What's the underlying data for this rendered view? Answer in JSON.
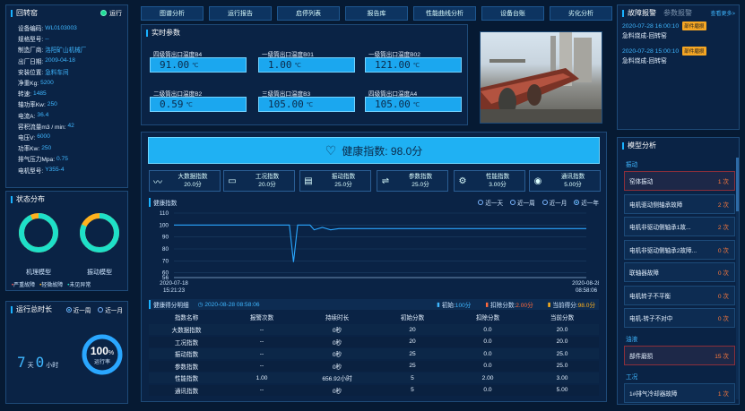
{
  "left": {
    "title": "回转窑",
    "status": "运行",
    "props": [
      {
        "k": "设备编码:",
        "v": "WL0103003"
      },
      {
        "k": "规格型号:",
        "v": "--"
      },
      {
        "k": "制造厂商:",
        "v": "洛阳矿山机械厂"
      },
      {
        "k": "出厂日期:",
        "v": "2009-04-18"
      },
      {
        "k": "安装位置:",
        "v": "急料车间"
      },
      {
        "k": "净重Kg:",
        "v": "5200"
      },
      {
        "k": "转速:",
        "v": "1485"
      },
      {
        "k": "轴功率Kw:",
        "v": "250"
      },
      {
        "k": "电流A:",
        "v": "36.4"
      },
      {
        "k": "容积流量m3 / min:",
        "v": "42"
      },
      {
        "k": "电压V:",
        "v": "6000"
      },
      {
        "k": "功率Kw:",
        "v": "250"
      },
      {
        "k": "排气压力Mpa:",
        "v": "0.75"
      },
      {
        "k": "电机型号:",
        "v": "Y355-4"
      }
    ],
    "status_title": "状态分布",
    "gauge1_label": "机理模型",
    "gauge2_label": "振动模型",
    "gauge1_fraction": 0.93,
    "gauge2_fraction": 0.82,
    "legend": [
      "严重故障",
      "轻微故障",
      "未见异常"
    ],
    "runtime_title": "运行总时长",
    "runtime_opts": [
      "近一周",
      "近一月"
    ],
    "runtime_days": "7",
    "runtime_hours": "0",
    "day_unit": "天",
    "hour_unit": "小时",
    "rate_value": "100",
    "rate_unit": "%",
    "rate_label": "运行率",
    "rate_fraction": 1.0
  },
  "tabs": [
    "图谱分析",
    "运行报告",
    "启停列表",
    "报告库",
    "性能曲线分析",
    "设备台账",
    "劣化分析"
  ],
  "realtime": {
    "title": "实时参数",
    "items": [
      {
        "name": "四级筒出口温度B4",
        "value": "91.00",
        "unit": "℃"
      },
      {
        "name": "一级筒出口温度B01",
        "value": "1.00",
        "unit": "℃"
      },
      {
        "name": "一级筒出口温度B02",
        "value": "121.00",
        "unit": "℃"
      },
      {
        "name": "二级筒出口温度B2",
        "value": "0.59",
        "unit": "℃"
      },
      {
        "name": "三级筒出口温度B3",
        "value": "105.00",
        "unit": "℃"
      },
      {
        "name": "四级筒出口温度A4",
        "value": "105.00",
        "unit": "℃"
      }
    ]
  },
  "health": {
    "label": "健康指数: 98.0分",
    "chips": [
      {
        "name": "大数据指数",
        "value": "20.0分",
        "icon": "〰"
      },
      {
        "name": "工况指数",
        "value": "20.0分",
        "icon": "▭"
      },
      {
        "name": "振动指数",
        "value": "25.0分",
        "icon": "▤"
      },
      {
        "name": "参数指数",
        "value": "25.0分",
        "icon": "⇌"
      },
      {
        "name": "性能指数",
        "value": "3.00分",
        "icon": "⚙"
      },
      {
        "name": "通讯指数",
        "value": "5.00分",
        "icon": "◉"
      }
    ],
    "chart_title": "健康指数",
    "chart_opts": [
      "近一天",
      "近一周",
      "近一月",
      "近一年"
    ]
  },
  "chart_data": {
    "type": "line",
    "title": "健康指数",
    "x_start": "2020-07-18 15:21:23",
    "x_end": "2020-08-28 08:58:06",
    "x_start_date": "2020-07-18",
    "x_start_time": "15:21:23",
    "x_end_date": "2020-08-28",
    "x_end_time": "08:58:06",
    "yticks": [
      "110",
      "100",
      "90",
      "80",
      "70",
      "60",
      "56"
    ],
    "ylim": [
      56,
      110
    ],
    "x": [
      0,
      0.28,
      0.29,
      0.3,
      0.33,
      0.34,
      0.36,
      0.38,
      0.4,
      0.42,
      1
    ],
    "y": [
      100,
      100,
      69,
      100,
      100,
      96,
      98,
      96,
      97,
      97,
      97
    ]
  },
  "score": {
    "title": "健康得分明细",
    "time": "2020-08-28 08:58:06",
    "init_label": "初始:",
    "init_value": "100分",
    "deduct_label": "扣除分数:",
    "deduct_value": "2.00分",
    "current_label": "当前得分:",
    "current_value": "98.0分",
    "headers": [
      "指数名称",
      "报警次数",
      "持续时长",
      "初始分数",
      "扣除分数",
      "当前分数"
    ],
    "rows": [
      [
        "大数据指数",
        "--",
        "0秒",
        "20",
        "0.0",
        "20.0"
      ],
      [
        "工况指数",
        "--",
        "0秒",
        "20",
        "0.0",
        "20.0"
      ],
      [
        "振动指数",
        "--",
        "0秒",
        "25",
        "0.0",
        "25.0"
      ],
      [
        "参数指数",
        "--",
        "0秒",
        "25",
        "0.0",
        "25.0"
      ],
      [
        "性能指数",
        "1.00",
        "656.92小时",
        "5",
        "2.00",
        "3.00"
      ],
      [
        "通讯指数",
        "--",
        "0秒",
        "5",
        "0.0",
        "5.00"
      ]
    ]
  },
  "alarm": {
    "tab1": "故障报警",
    "tab2": "参数报警",
    "more": "查看更多>",
    "items": [
      {
        "time": "2020-07-28 16:00:10",
        "badge": "部件磨损",
        "desc": "急料烧成-回转窑"
      },
      {
        "time": "2020-07-28 15:00:10",
        "badge": "部件磨损",
        "desc": "急料烧成-回转窑"
      }
    ]
  },
  "model": {
    "title": "模型分析",
    "group1": "振动",
    "vib": [
      {
        "name": "窑体振动",
        "cnt": "1 次",
        "hl": true
      },
      {
        "name": "电机驱动侧轴承故障",
        "cnt": "2 次",
        "hl": false
      },
      {
        "name": "电机非驱动侧轴承1故...",
        "cnt": "2 次",
        "hl": false
      },
      {
        "name": "电机非驱动侧轴承2故障...",
        "cnt": "0 次",
        "hl": false
      },
      {
        "name": "联轴器故障",
        "cnt": "0 次",
        "hl": false
      },
      {
        "name": "电机转子不平衡",
        "cnt": "0 次",
        "hl": false
      },
      {
        "name": "电机-转子不对中",
        "cnt": "0 次",
        "hl": false
      }
    ],
    "group2": "油液",
    "oil": [
      {
        "name": "部件磨损",
        "cnt": "15 次"
      }
    ],
    "group3": "工况",
    "work": [
      {
        "name": "1#排气冷却器故障",
        "cnt": "1 次"
      }
    ]
  }
}
